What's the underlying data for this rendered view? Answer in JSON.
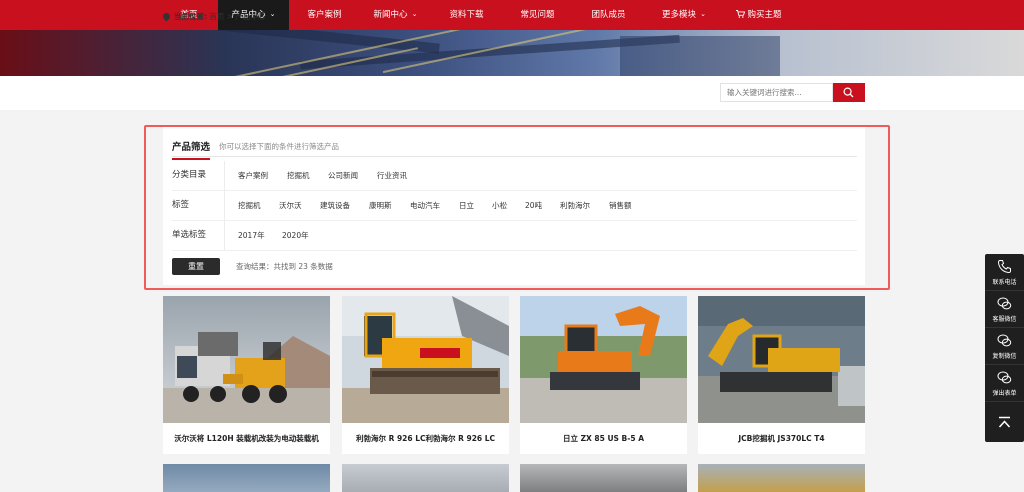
{
  "nav": {
    "items": [
      {
        "label": "首页",
        "caret": false
      },
      {
        "label": "产品中心",
        "caret": true
      },
      {
        "label": "客户案例",
        "caret": false
      },
      {
        "label": "新闻中心",
        "caret": true
      },
      {
        "label": "资料下载",
        "caret": false
      },
      {
        "label": "常见问题",
        "caret": false
      },
      {
        "label": "团队成员",
        "caret": false
      },
      {
        "label": "更多模块",
        "caret": true
      }
    ],
    "active_index": 1,
    "buy_label": "购买主题",
    "accent_color": "#c8101e"
  },
  "breadcrumb": {
    "prefix": "当前位置:",
    "path": "首页 > 产品中心"
  },
  "search": {
    "placeholder": "输入关键词进行搜索..."
  },
  "filter": {
    "title": "产品筛选",
    "subtitle": "你可以选择下面的条件进行筛选产品",
    "rows": [
      {
        "label": "分类目录",
        "tags": [
          "客户案例",
          "挖掘机",
          "公司新闻",
          "行业资讯"
        ]
      },
      {
        "label": "标签",
        "tags": [
          "挖掘机",
          "沃尔沃",
          "建筑设备",
          "康明斯",
          "电动汽车",
          "日立",
          "小松",
          "20吨",
          "利勃海尔",
          "销售额"
        ]
      },
      {
        "label": "单选标签",
        "tags": [
          "2017年",
          "2020年"
        ]
      }
    ],
    "reset_label": "重置",
    "result_text": "查询结果：共找到 23 条数据"
  },
  "products": [
    {
      "title": "沃尔沃将 L120H 装载机改装为电动装载机"
    },
    {
      "title": "利勃海尔 R 926 LC利勃海尔 R 926 LC"
    },
    {
      "title": "日立 ZX 85 US B-5 A"
    },
    {
      "title": "JCB挖掘机 JS370LC T4"
    }
  ],
  "side_bar": {
    "items": [
      {
        "label": "联系电话",
        "icon": "phone-icon"
      },
      {
        "label": "客服微信",
        "icon": "wechat-icon"
      },
      {
        "label": "复制微信",
        "icon": "wechat-copy-icon"
      },
      {
        "label": "弹出表单",
        "icon": "form-icon"
      }
    ],
    "top_icon": "back-to-top-icon"
  }
}
